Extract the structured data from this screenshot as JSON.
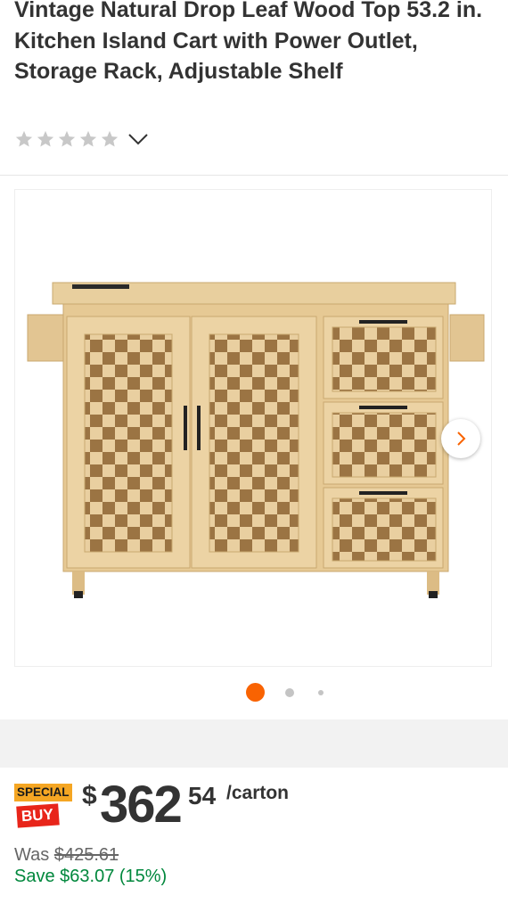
{
  "product": {
    "title": "Vintage Natural Drop Leaf Wood Top 53.2 in. Kitchen Island Cart with Power Outlet, Storage Rack, Adjustable Shelf",
    "rating": {
      "stars_filled": 0,
      "stars_total": 5
    }
  },
  "gallery": {
    "image_icon": "kitchen-island-cart-image",
    "next_icon": "chevron-right-icon",
    "current_index": 0,
    "total_dots": 3
  },
  "pricing": {
    "badge_top": "SPECIAL",
    "badge_bottom": "BUY",
    "currency": "$",
    "dollars": "362",
    "cents": "54",
    "unit": "/carton",
    "was_label": "Was",
    "was_price": "$425.61",
    "save_text": "Save $63.07 (15%)"
  },
  "colors": {
    "accent_orange": "#f96302",
    "special_buy_yellow": "#f5a623",
    "special_buy_red": "#e8251a",
    "savings_green": "#00873c",
    "star_gray": "#c8c8c8"
  }
}
